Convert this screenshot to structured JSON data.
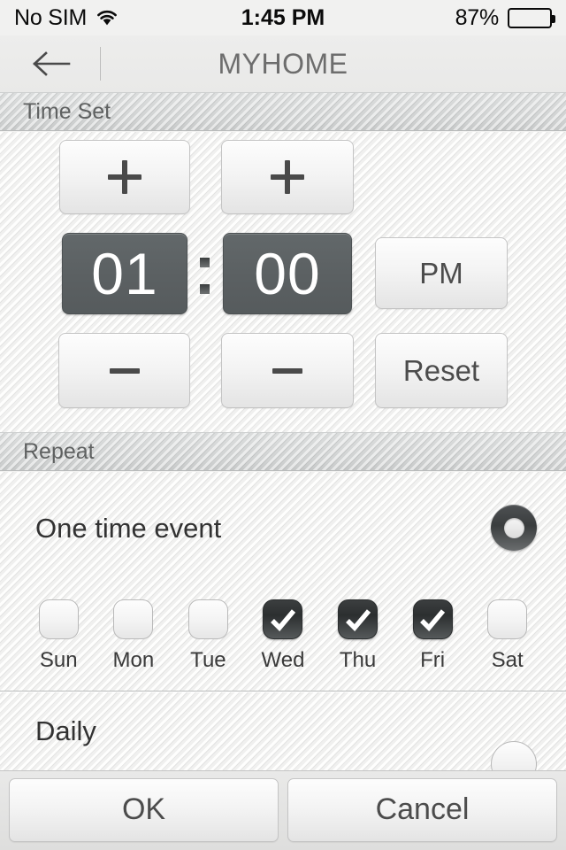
{
  "status_bar": {
    "carrier": "No SIM",
    "wifi_icon": "wifi-icon",
    "time": "1:45 PM",
    "battery_percent": "87%",
    "battery_level": 87,
    "battery_icon": "battery-icon"
  },
  "nav_bar": {
    "back_icon": "arrow-left-icon",
    "title": "MYHOME"
  },
  "sections": {
    "time_set": {
      "header": "Time Set",
      "hour_increment_label": "+",
      "minute_increment_label": "+",
      "hour_decrement_label": "–",
      "minute_decrement_label": "–",
      "hour_value": "01",
      "minute_value": "00",
      "separator": ":",
      "meridiem_label": "PM",
      "reset_label": "Reset"
    },
    "repeat": {
      "header": "Repeat",
      "options": [
        {
          "label": "One time event",
          "selected": true
        },
        {
          "label": "Daily",
          "selected": false
        }
      ],
      "days": [
        {
          "label": "Sun",
          "checked": false
        },
        {
          "label": "Mon",
          "checked": false
        },
        {
          "label": "Tue",
          "checked": false
        },
        {
          "label": "Wed",
          "checked": true
        },
        {
          "label": "Thu",
          "checked": true
        },
        {
          "label": "Fri",
          "checked": true
        },
        {
          "label": "Sat",
          "checked": false
        }
      ]
    }
  },
  "toolbar": {
    "ok_label": "OK",
    "cancel_label": "Cancel"
  },
  "colors": {
    "body_bg": "#f0f0ef",
    "section_header_bg": "#d3d5d5",
    "time_box_bg": "#5b6062",
    "time_box_text": "#ffffff",
    "nav_title": "#6d6d6d",
    "checkbox_on": "#2c2f30",
    "divider": "#b8baba"
  }
}
